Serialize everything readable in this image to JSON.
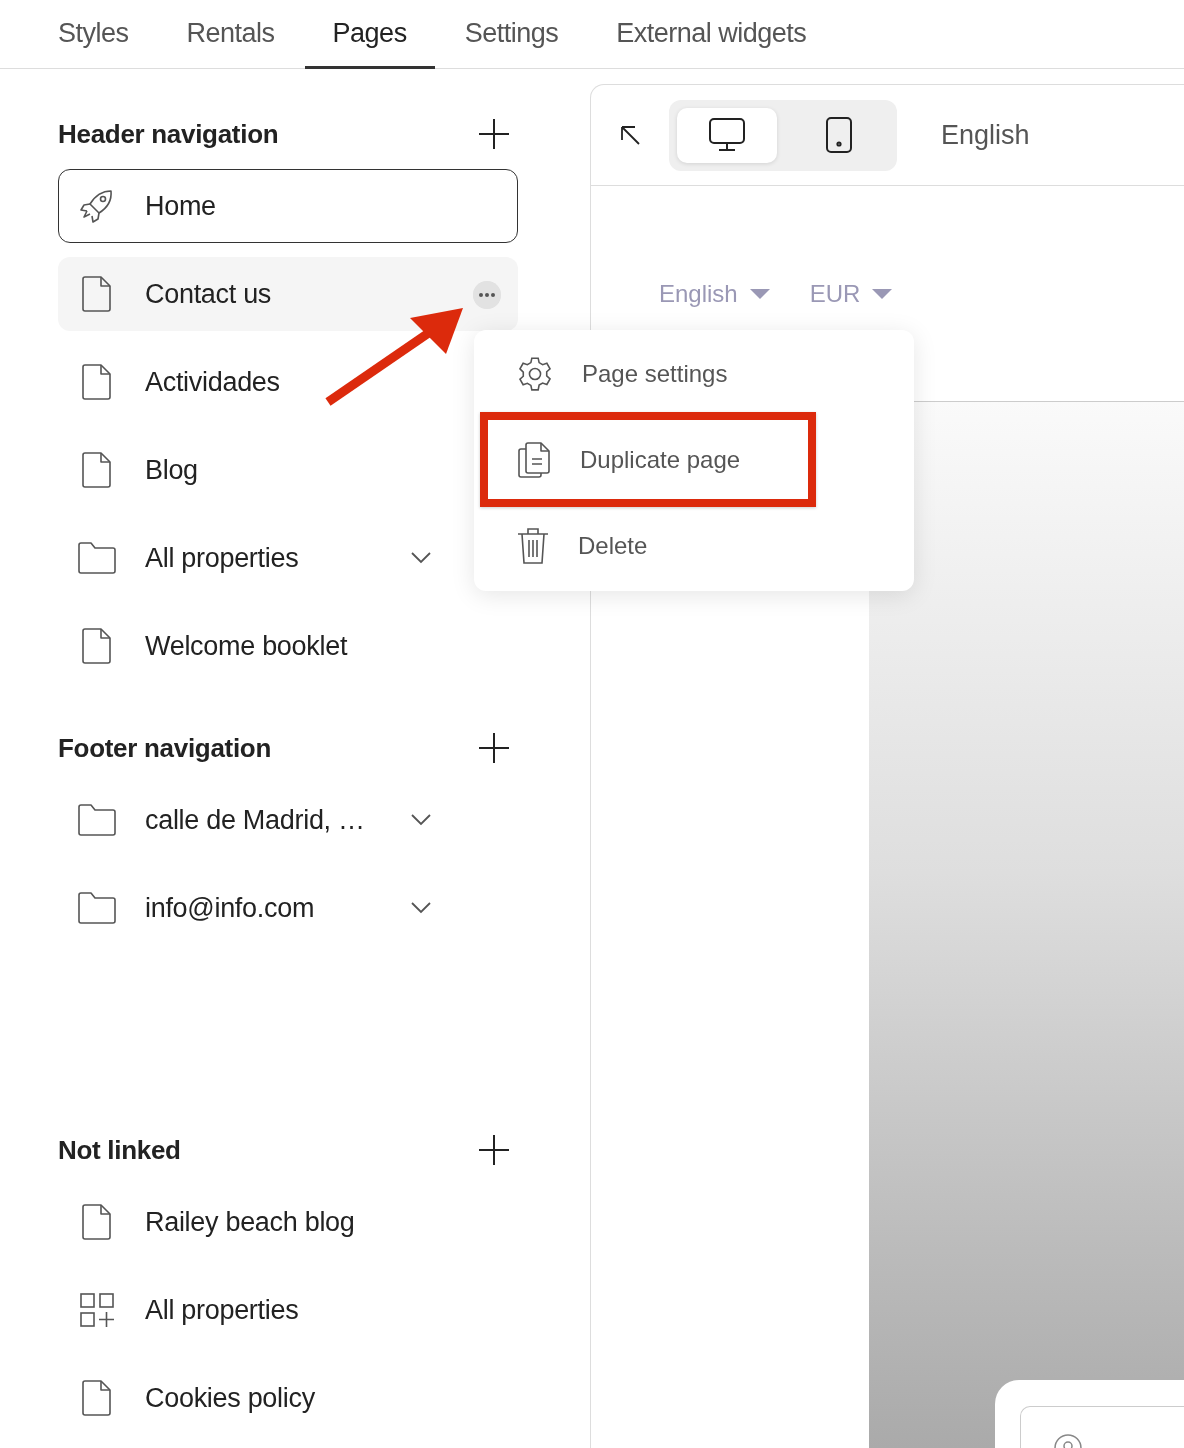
{
  "tabs": [
    {
      "label": "Styles",
      "selected": false
    },
    {
      "label": "Rentals",
      "selected": false
    },
    {
      "label": "Pages",
      "selected": true
    },
    {
      "label": "Settings",
      "selected": false
    },
    {
      "label": "External widgets",
      "selected": false
    }
  ],
  "sections": [
    {
      "title": "Header navigation",
      "items": [
        {
          "label": "Home",
          "kind": "rocket",
          "selected": true,
          "hovered": false,
          "expandable": false
        },
        {
          "label": "Contact us",
          "kind": "page",
          "selected": false,
          "hovered": true,
          "expandable": false
        },
        {
          "label": "Actividades",
          "kind": "page",
          "selected": false,
          "hovered": false,
          "expandable": false
        },
        {
          "label": "Blog",
          "kind": "page",
          "selected": false,
          "hovered": false,
          "expandable": false
        },
        {
          "label": "All properties",
          "kind": "folder",
          "selected": false,
          "hovered": false,
          "expandable": true
        },
        {
          "label": "Welcome booklet",
          "kind": "page",
          "selected": false,
          "hovered": false,
          "expandable": false
        }
      ]
    },
    {
      "title": "Footer navigation",
      "items": [
        {
          "label": "calle de Madrid, …",
          "kind": "folder",
          "selected": false,
          "hovered": false,
          "expandable": true
        },
        {
          "label": "info@info.com",
          "kind": "folder",
          "selected": false,
          "hovered": false,
          "expandable": true
        }
      ]
    },
    {
      "title": "Not linked",
      "items": [
        {
          "label": "Railey beach blog",
          "kind": "page",
          "selected": false,
          "hovered": false,
          "expandable": false
        },
        {
          "label": "All properties",
          "kind": "grid",
          "selected": false,
          "hovered": false,
          "expandable": false
        },
        {
          "label": "Cookies policy",
          "kind": "page",
          "selected": false,
          "hovered": false,
          "expandable": false
        }
      ]
    }
  ],
  "menu": {
    "items": [
      {
        "label": "Page settings",
        "kind": "settings",
        "highlighted": false
      },
      {
        "label": "Duplicate page",
        "kind": "duplicate",
        "highlighted": true
      },
      {
        "label": "Delete",
        "kind": "delete",
        "highlighted": false
      }
    ]
  },
  "preview": {
    "devices": [
      {
        "kind": "desktop",
        "selected": true
      },
      {
        "kind": "mobile",
        "selected": false
      }
    ],
    "language": "English",
    "selectors": [
      {
        "label": "English"
      },
      {
        "label": "EUR"
      }
    ]
  }
}
